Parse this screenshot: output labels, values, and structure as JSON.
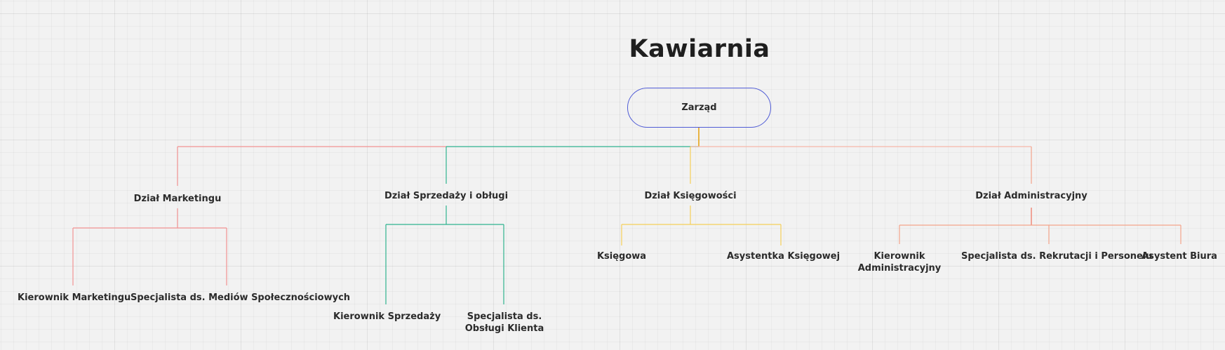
{
  "diagram": {
    "title": "Kawiarnia",
    "root": {
      "label": "Zarząd",
      "border_color": "#4f5bd5"
    },
    "departments": [
      {
        "label": "Dział Marketingu",
        "color": "#f29393",
        "children": [
          "Kierownik Marketingu",
          "Specjalista ds. Mediów Społecznościowych"
        ]
      },
      {
        "label": "Dział Sprzedaży i obługi",
        "color": "#2fb38f",
        "children": [
          "Kierownik Sprzedaży",
          "Specjalista ds. Obsługi Klienta"
        ]
      },
      {
        "label": "Dział Księgowości",
        "color": "#f5cf5a",
        "children": [
          "Księgowa",
          "Asystentka Księgowej"
        ]
      },
      {
        "label": "Dział Administracyjny",
        "color": "#f4a48a",
        "children": [
          "Kierownik Administracyjny",
          "Specjalista ds. Rekrutacji i Personelu",
          "Asystent Biura"
        ]
      }
    ],
    "connector_colors": {
      "trunk": "#e6a417",
      "main_bus": "#f7b7a8"
    }
  }
}
